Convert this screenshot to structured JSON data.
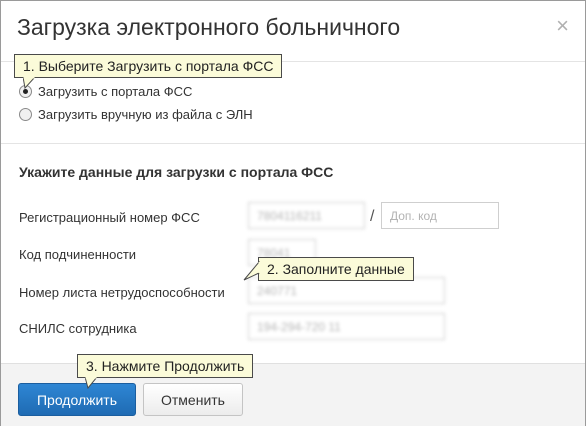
{
  "dialog": {
    "title": "Загрузка электронного больничного",
    "close_glyph": "×"
  },
  "source_options": [
    {
      "label": "Загрузить с портала ФСС",
      "selected": true
    },
    {
      "label": "Загрузить вручную из файла с ЭЛН",
      "selected": false
    }
  ],
  "form": {
    "section_title": "Укажите данные для загрузки с портала ФСС",
    "reg_number_label": "Регистрационный номер ФСС",
    "reg_number_value": "7804116211",
    "extra_code_placeholder": "Доп. код",
    "slash": "/",
    "subordination_label": "Код подчиненности",
    "subordination_value": "78041",
    "sheet_number_label": "Номер листа нетрудоспособности",
    "sheet_number_value": "240771",
    "snils_label": "СНИЛС сотрудника",
    "snils_value": "194-294-720 11"
  },
  "buttons": {
    "continue_label": "Продолжить",
    "cancel_label": "Отменить"
  },
  "hints": {
    "step1": "1. Выберите Загрузить с портала ФСС",
    "step2": "2. Заполните данные",
    "step3": "3. Нажмите Продолжить"
  },
  "colors": {
    "primary_button": "#1f6bb3",
    "hint_background": "#fbfbd9"
  }
}
